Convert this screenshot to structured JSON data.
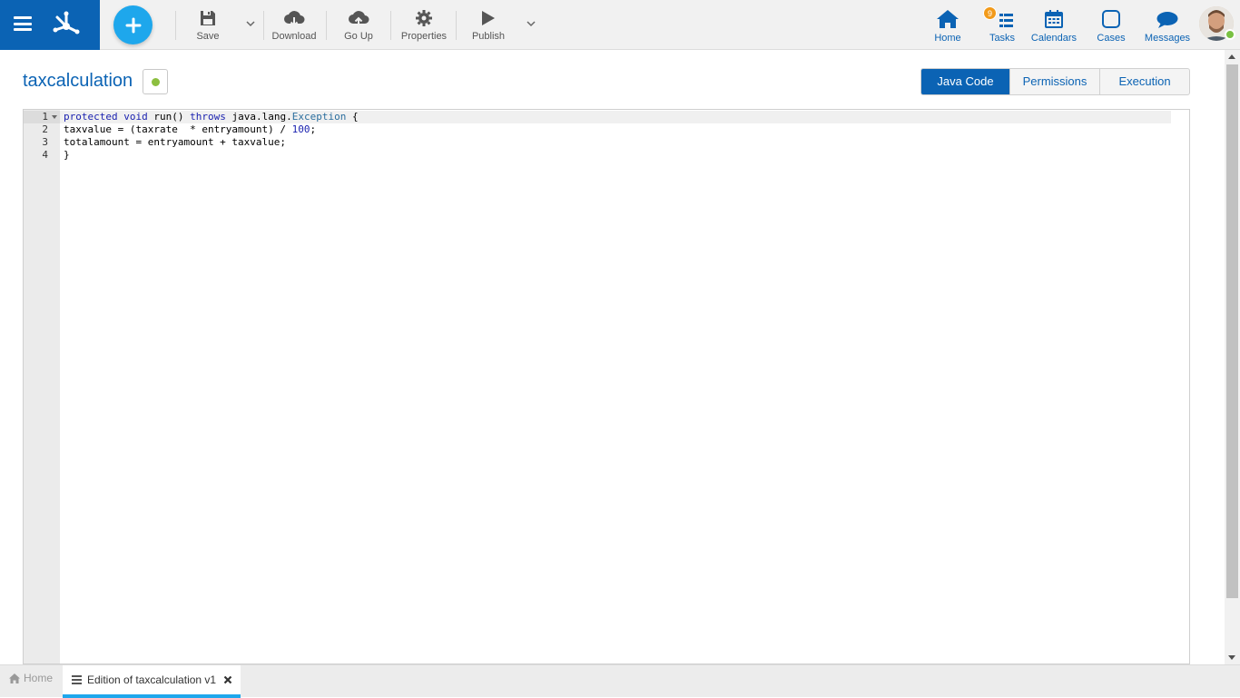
{
  "toolbar": {
    "save_label": "Save",
    "download_label": "Download",
    "goup_label": "Go Up",
    "properties_label": "Properties",
    "publish_label": "Publish"
  },
  "nav": {
    "home_label": "Home",
    "tasks_label": "Tasks",
    "tasks_badge": "9",
    "calendars_label": "Calendars",
    "cases_label": "Cases",
    "messages_label": "Messages"
  },
  "page": {
    "title": "taxcalculation"
  },
  "tabs": [
    {
      "label": "Java Code",
      "active": true
    },
    {
      "label": "Permissions",
      "active": false
    },
    {
      "label": "Execution",
      "active": false
    }
  ],
  "editor": {
    "line_numbers": [
      "1",
      "2",
      "3",
      "4"
    ],
    "line1": {
      "kw1": "protected",
      "kw2": "void",
      "t1": "run() ",
      "kw3": "throws",
      "t2": "java.lang.",
      "cls": "Exception",
      "t3": " {"
    },
    "line2": {
      "t1": "taxvalue = (taxrate  * entryamount) / ",
      "num": "100",
      "t2": ";"
    },
    "line3": "totalamount = entryamount + taxvalue;",
    "line4": "}"
  },
  "bottom_tabs": {
    "home_label": "Home",
    "active_label": "Edition of taxcalculation v1"
  },
  "colors": {
    "brand": "#0b63b4",
    "accent": "#1ea7ec",
    "badge": "#f29a1a",
    "status_ok": "#8cbf3f"
  }
}
